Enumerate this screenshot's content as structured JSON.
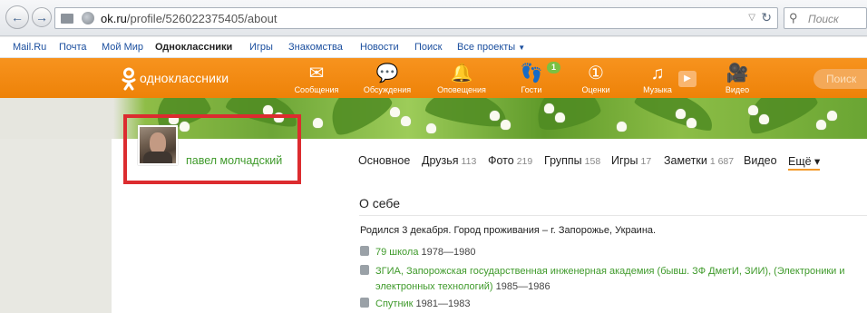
{
  "browser": {
    "url_host": "ok.ru",
    "url_path": "/profile/526022375405/about",
    "search_placeholder": "Поиск"
  },
  "portal": {
    "links": [
      "Mail.Ru",
      "Почта",
      "Мой Мир",
      "Одноклассники",
      "Игры",
      "Знакомства",
      "Новости",
      "Поиск",
      "Все проекты"
    ],
    "active": "Одноклассники"
  },
  "ok_header": {
    "logo_text": "одноклассники",
    "nav": [
      {
        "label": "Сообщения",
        "icon": "envelope-icon"
      },
      {
        "label": "Обсуждения",
        "icon": "chat-bubbles-icon"
      },
      {
        "label": "Оповещения",
        "icon": "bell-icon"
      },
      {
        "label": "Гости",
        "icon": "footprints-icon"
      },
      {
        "label": "Оценки",
        "icon": "rating-icon"
      },
      {
        "label": "Музыка",
        "icon": "music-note-icon"
      },
      {
        "label": "Видео",
        "icon": "video-camera-icon"
      }
    ],
    "guests_badge": "1",
    "search_placeholder": "Поиск",
    "colors": {
      "header": "#ee8208",
      "badge": "#7ac043"
    }
  },
  "profile": {
    "name": "павел молчадский",
    "name_color": "#3f9a2b"
  },
  "tabs": [
    {
      "label": "Основное",
      "count": ""
    },
    {
      "label": "Друзья",
      "count": "113"
    },
    {
      "label": "Фото",
      "count": "219"
    },
    {
      "label": "Группы",
      "count": "158"
    },
    {
      "label": "Игры",
      "count": "17"
    },
    {
      "label": "Заметки",
      "count": "1 687"
    },
    {
      "label": "Видео",
      "count": ""
    },
    {
      "label": "Ещё ▾",
      "count": ""
    }
  ],
  "about": {
    "title": "О себе",
    "summary": "Родился 3 декабря. Город проживания – г. Запорожье, Украина.",
    "education": [
      {
        "name": "79 школа",
        "years": "1978—1980",
        "icon": "school-icon"
      },
      {
        "name": "ЗГИА, Запорожская государственная инженерная академия (бывш. ЗФ ДметИ, ЗИИ), (Электроники и",
        "name_cont": "электронных технологий)",
        "years": "1985—1986",
        "icon": "university-icon"
      },
      {
        "name": "Спутник",
        "years": "1981—1983",
        "icon": "camp-icon"
      }
    ]
  }
}
